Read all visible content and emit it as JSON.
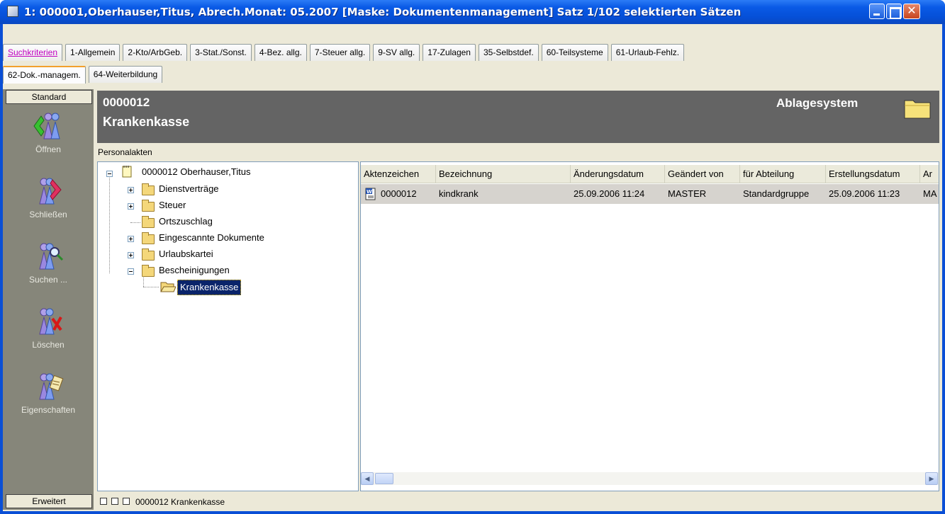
{
  "window": {
    "title": "1:  000001,Oberhauser,Titus, Abrech.Monat: 05.2007   [Maske: Dokumentenmanagement]    Satz 1/102 selektierten Sätzen"
  },
  "tabs_row1": [
    "Suchkriterien",
    "1-Allgemein",
    "2-Kto/ArbGeb.",
    "3-Stat./Sonst.",
    "4-Bez. allg.",
    "7-Steuer allg.",
    "9-SV allg.",
    "17-Zulagen",
    "35-Selbstdef.",
    "60-Teilsysteme",
    "61-Urlaub-Fehlz."
  ],
  "tabs_row2": [
    "62-Dok.-managem.",
    "64-Weiterbildung"
  ],
  "sidebar": {
    "header": "Standard",
    "footer": "Erweitert",
    "items": [
      "Öffnen",
      "Schließen",
      "Suchen ...",
      "Löschen",
      "Eigenschaften"
    ]
  },
  "header": {
    "number": "0000012",
    "name": "Krankenkasse",
    "right_title": "Ablagesystem"
  },
  "tree": {
    "label": "Personalakten",
    "root": "0000012 Oberhauser,Titus",
    "nodes": [
      "Dienstverträge",
      "Steuer",
      "Ortszuschlag",
      "Eingescannte Dokumente",
      "Urlaubskartei",
      "Bescheinigungen"
    ],
    "selected": "Krankenkasse"
  },
  "list": {
    "columns": [
      "Aktenzeichen",
      "Bezeichnung",
      "Änderungsdatum",
      "Geändert von",
      "für Abteilung",
      "Erstellungsdatum",
      "Ar"
    ],
    "rows": [
      [
        "0000012",
        "kindkrank",
        "25.09.2006 11:24",
        "MASTER",
        "Standardgruppe",
        "25.09.2006 11:23",
        "MA"
      ]
    ]
  },
  "status": {
    "text": "0000012 Krankenkasse"
  },
  "colors": {
    "titlebar": "#0a5ae6",
    "header_bg": "#646464",
    "sidebar_bg": "#86867a",
    "face": "#ece9d8",
    "active_tab_accent": "#f2a02c"
  }
}
